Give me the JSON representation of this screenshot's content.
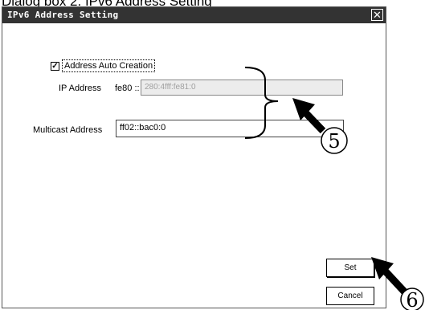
{
  "caption": "Dialog box 2. IPv6 Address Setting",
  "window": {
    "title": "IPv6 Address Setting",
    "close_glyph": "✕"
  },
  "form": {
    "auto_creation": {
      "checked": true,
      "check_glyph": "✓",
      "label": "Address Auto Creation"
    },
    "ip_address": {
      "label": "IP Address",
      "prefix": "fe80 ::",
      "value": "280:4fff:fe81:0",
      "disabled": true
    },
    "multicast_address": {
      "label": "Multicast Address",
      "value": "ff02::bac0:0"
    }
  },
  "buttons": {
    "set_label": "Set",
    "cancel_label": "Cancel"
  },
  "annotations": {
    "callout_5": "5",
    "callout_6": "6"
  }
}
